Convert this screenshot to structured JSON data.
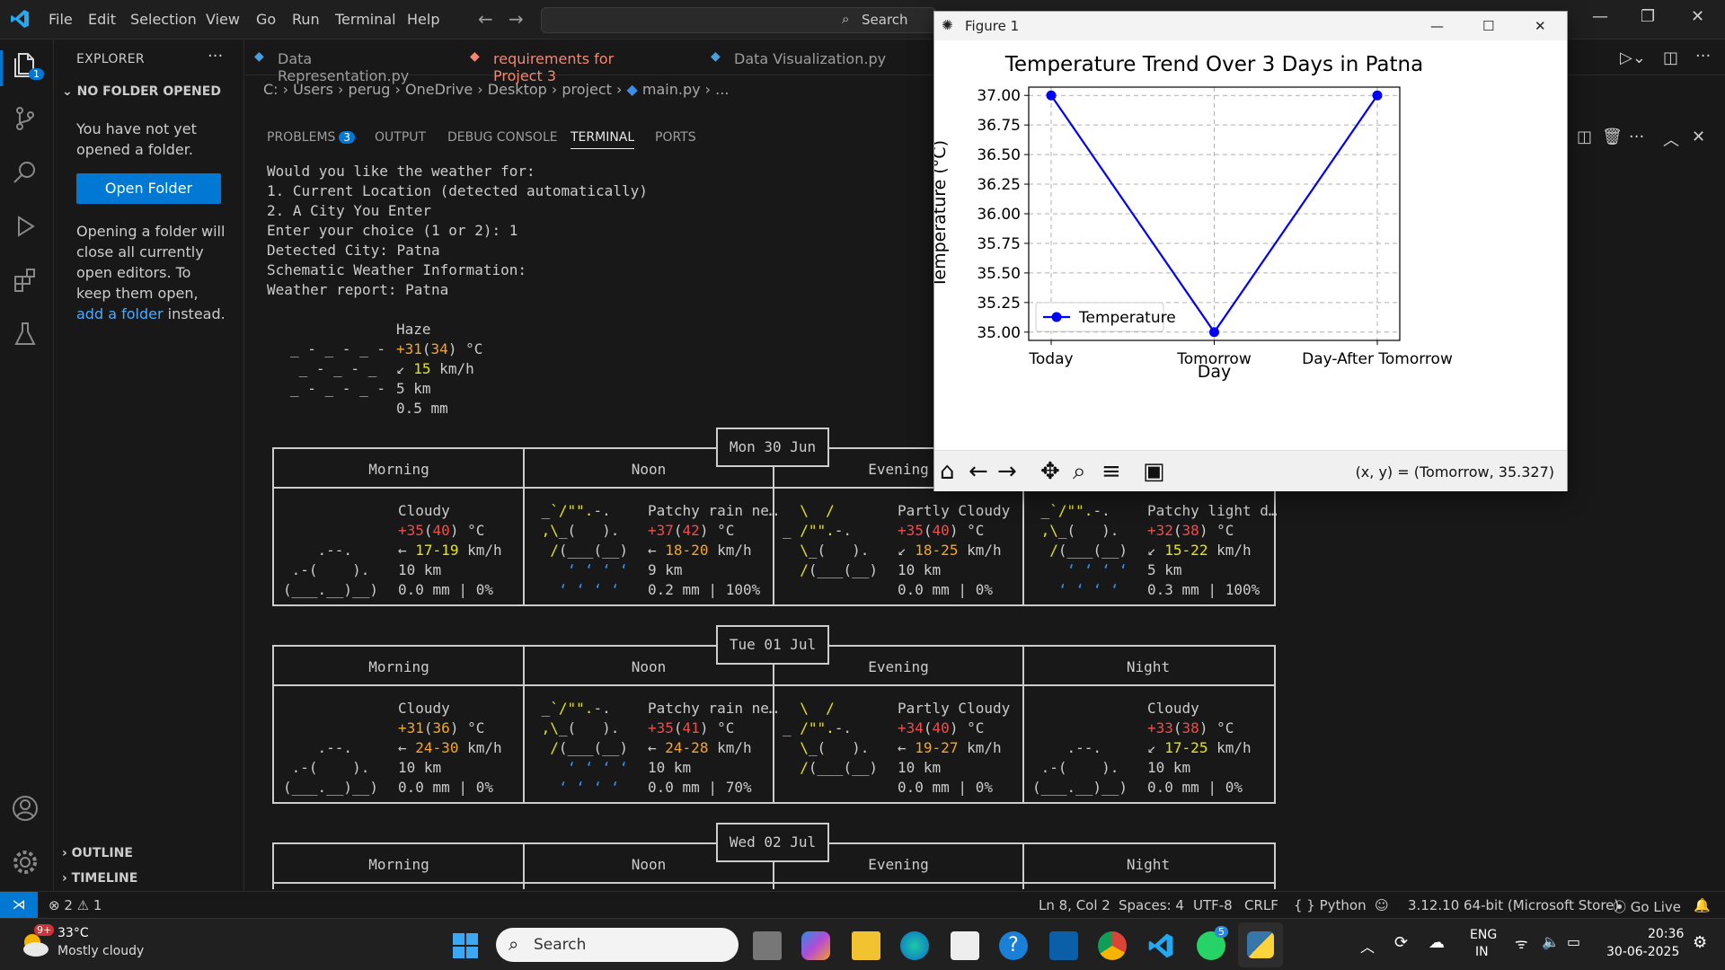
{
  "menu": [
    "File",
    "Edit",
    "Selection",
    "View",
    "Go",
    "Run",
    "Terminal",
    "Help"
  ],
  "command_center": {
    "label": "Search"
  },
  "explorer": {
    "title": "EXPLORER",
    "no_folder": "NO FOLDER OPENED",
    "msg1": "You have not yet opened a folder.",
    "open_folder": "Open Folder",
    "msg2_pre": "Opening a folder will close all currently open editors. To keep them open, ",
    "msg2_link": "add a folder",
    "msg2_post": " instead.",
    "outline": "OUTLINE",
    "timeline": "TIMELINE",
    "badge": "1"
  },
  "tabs": [
    {
      "label": "Data Representation.py"
    },
    {
      "label": "requirements for Project 3"
    },
    {
      "label": "Data Visualization.py"
    }
  ],
  "breadcrumb": [
    "C:",
    "Users",
    "perug",
    "OneDrive",
    "Desktop",
    "project",
    "main.py",
    "..."
  ],
  "panel_tabs": {
    "problems": "PROBLEMS",
    "problems_count": "3",
    "output": "OUTPUT",
    "debug": "DEBUG CONSOLE",
    "terminal": "TERMINAL",
    "ports": "PORTS"
  },
  "terminal": {
    "lines": [
      "Would you like the weather for:",
      "1. Current Location (detected automatically)",
      "2. A City You Enter",
      "Enter your choice (1 or 2): 1",
      "Detected City: Patna",
      "Schematic Weather Information:",
      "Weather report: Patna"
    ],
    "current": {
      "cond": "Haze",
      "temp": "+31",
      "feels": "34",
      "unit": " °C",
      "wind_dir": "↙",
      "wind": "15",
      "wind_unit": " km/h",
      "vis": "5 km",
      "precip": "0.5 mm"
    },
    "periods": [
      "Morning",
      "Noon",
      "Evening",
      "Night"
    ],
    "days": [
      {
        "date": "Mon 30 Jun",
        "cells": [
          {
            "cond": "Cloudy",
            "t": "+35",
            "f": "40",
            "dir": "←",
            "w": "17-19",
            "vis": "10 km",
            "pr": "0.0 mm | 0%"
          },
          {
            "cond": "Patchy rain ne…",
            "t": "+37",
            "f": "42",
            "dir": "←",
            "w": "18-20",
            "vis": "9 km",
            "pr": "0.2 mm | 100%"
          },
          {
            "cond": "Partly Cloudy",
            "t": "+35",
            "f": "40",
            "dir": "↙",
            "w": "18-25",
            "vis": "10 km",
            "pr": "0.0 mm | 0%"
          },
          {
            "cond": "Patchy light d…",
            "t": "+32",
            "f": "38",
            "dir": "↙",
            "w": "15-22",
            "vis": "5 km",
            "pr": "0.3 mm | 100%"
          }
        ]
      },
      {
        "date": "Tue 01 Jul",
        "cells": [
          {
            "cond": "Cloudy",
            "t": "+31",
            "f": "36",
            "dir": "←",
            "w": "24-30",
            "vis": "10 km",
            "pr": "0.0 mm | 0%"
          },
          {
            "cond": "Patchy rain ne…",
            "t": "+35",
            "f": "41",
            "dir": "←",
            "w": "24-28",
            "vis": "10 km",
            "pr": "0.0 mm | 70%"
          },
          {
            "cond": "Partly Cloudy",
            "t": "+34",
            "f": "40",
            "dir": "←",
            "w": "19-27",
            "vis": "10 km",
            "pr": "0.0 mm | 0%"
          },
          {
            "cond": "Cloudy",
            "t": "+33",
            "f": "38",
            "dir": "↙",
            "w": "17-25",
            "vis": "10 km",
            "pr": "0.0 mm | 0%"
          }
        ]
      },
      {
        "date": "Wed 02 Jul",
        "cells": []
      }
    ]
  },
  "figure": {
    "window_title": "Figure 1",
    "coords": "(x, y) = (Tomorrow, 35.327)"
  },
  "chart_data": {
    "type": "line",
    "title": "Temperature Trend Over 3 Days in Patna",
    "xlabel": "Day",
    "ylabel": "Temperature (°C)",
    "categories": [
      "Today",
      "Tomorrow",
      "Day-After Tomorrow"
    ],
    "series": [
      {
        "name": "Temperature",
        "values": [
          37.0,
          35.0,
          37.0
        ],
        "color": "#0000ff"
      }
    ],
    "ylim": [
      34.93,
      37.07
    ],
    "yticks": [
      "35.00",
      "35.25",
      "35.50",
      "35.75",
      "36.00",
      "36.25",
      "36.50",
      "36.75",
      "37.00"
    ],
    "grid": true,
    "legend": "lower-left"
  },
  "statusbar": {
    "errors": "2",
    "warnings": "1",
    "pos": "Ln 8, Col 2",
    "spaces": "Spaces: 4",
    "enc": "UTF-8",
    "eol": "CRLF",
    "lang": "Python",
    "interp": "3.12.10 64-bit (Microsoft Store)",
    "golive": "Go Live"
  },
  "taskbar": {
    "weather_temp": "33°C",
    "weather_desc": "Mostly cloudy",
    "weather_badge": "9+",
    "search": "Search",
    "lang1": "ENG",
    "lang2": "IN",
    "time": "20:36",
    "date": "30-06-2025",
    "whatsapp_badge": "5"
  }
}
